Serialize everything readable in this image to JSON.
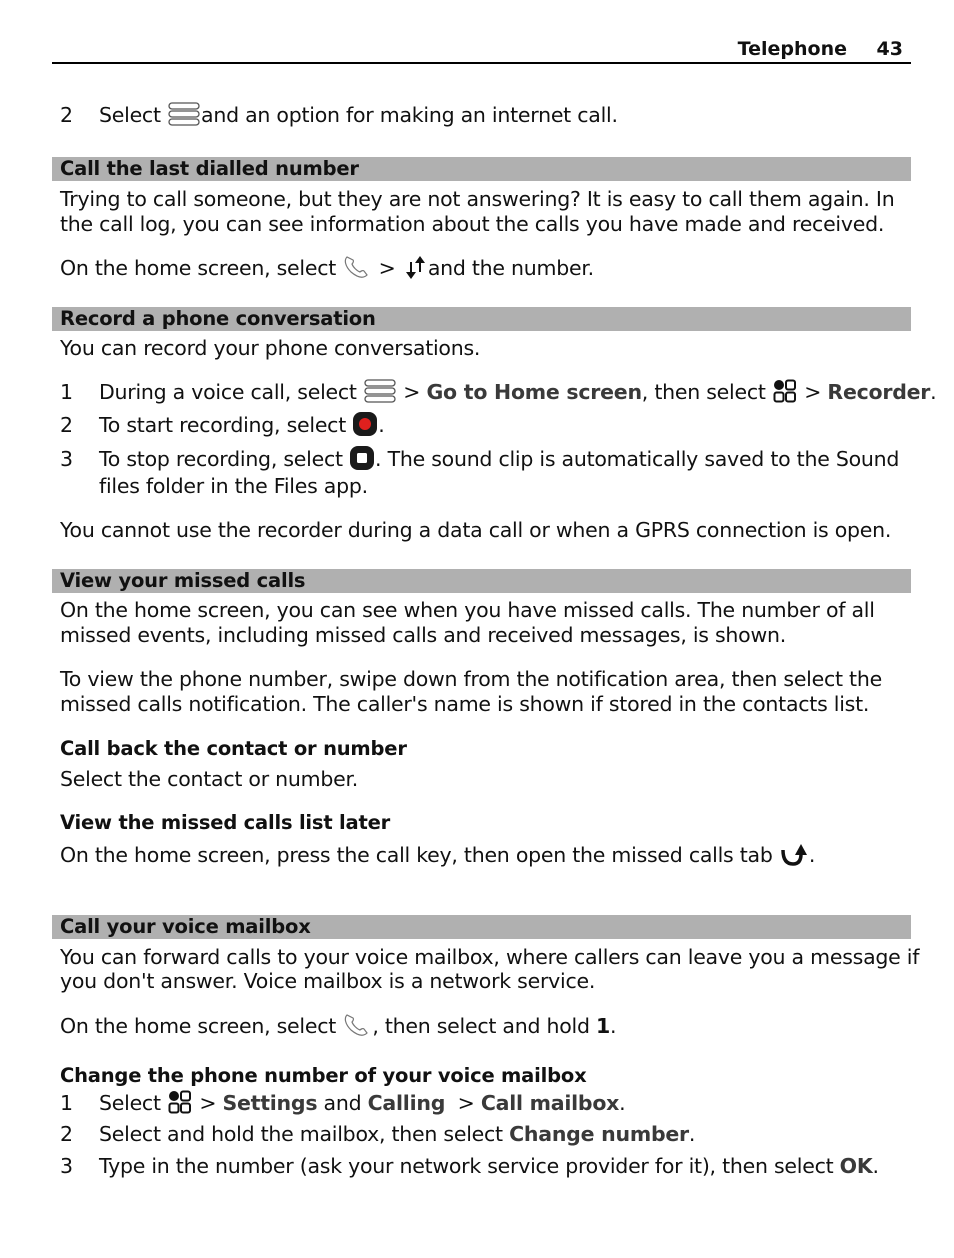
{
  "header": {
    "title": "Telephone",
    "page_number": "43"
  },
  "intro_step": {
    "number": "2",
    "text_before": "Select",
    "icon": "menu-icon",
    "text_after": "and an option for making an internet call."
  },
  "sections": {
    "last_dialled": {
      "heading": "Call the last dialled number",
      "para1_line1": "Trying to call someone, but they are not answering? It is easy to call them again. In",
      "para1_line2": "the call log, you can see information about the calls you have made and received.",
      "para2_before": "On the home screen, select",
      "para2_sep": ">",
      "para2_after": "and the number.",
      "icons": [
        "phone-handset-icon",
        "call-log-arrows-icon"
      ]
    },
    "record": {
      "heading": "Record a phone conversation",
      "intro": "You can record your phone conversations.",
      "steps": [
        {
          "number": "1",
          "a": "During a voice call, select",
          "b": "> ",
          "ui1": "Go to Home screen",
          "c": ", then select",
          "d": "> ",
          "ui2": "Recorder",
          "e": "."
        },
        {
          "number": "2",
          "a": "To start recording, select",
          "b": "."
        },
        {
          "number": "3",
          "a": "To stop recording, select",
          "b": ". The sound clip is automatically saved to the Sound",
          "c": "files folder in the Files app."
        }
      ],
      "note": "You cannot use the recorder during a data call or when a GPRS connection is open."
    },
    "missed": {
      "heading": "View your missed calls",
      "para1_line1": "On the home screen, you can see when you have missed calls. The number of all",
      "para1_line2": "missed events, including missed calls and received messages, is shown.",
      "para2_line1": "To view the phone number, swipe down from the notification area, then select the",
      "para2_line2": "missed calls notification. The caller's name is shown if stored in the contacts list.",
      "sub1_heading": "Call back the contact or number",
      "sub1_text": "Select the contact or number.",
      "sub2_heading": "View the missed calls list later",
      "sub2_text": "On the home screen, press the call key, then open the missed calls tab",
      "sub2_end": "."
    },
    "mailbox": {
      "heading": "Call your voice mailbox",
      "para1_line1": "You can forward calls to your voice mailbox, where callers can leave you a message if",
      "para1_line2": "you don't answer. Voice mailbox is a network service.",
      "para2_before": "On the home screen, select",
      "para2_after": ", then select and hold",
      "para2_key": "1",
      "para2_end": ".",
      "sub_heading": "Change the phone number of your voice mailbox",
      "steps": [
        {
          "number": "1",
          "a": "Select",
          "b": "> ",
          "ui1": "Settings",
          "c": " and ",
          "ui2": "Calling",
          "d": "  > ",
          "ui3": "Call mailbox",
          "e": "."
        },
        {
          "number": "2",
          "a": "Select and hold the mailbox, then select ",
          "ui1": "Change number",
          "b": "."
        },
        {
          "number": "3",
          "a": "Type in the number (ask your network service provider for it), then select ",
          "ui1": "OK",
          "b": "."
        }
      ]
    }
  },
  "colors": {
    "heading_band": "#b0b0b0",
    "record_red": "#e0201e",
    "ui_bold_text": "#3a3a3a"
  }
}
